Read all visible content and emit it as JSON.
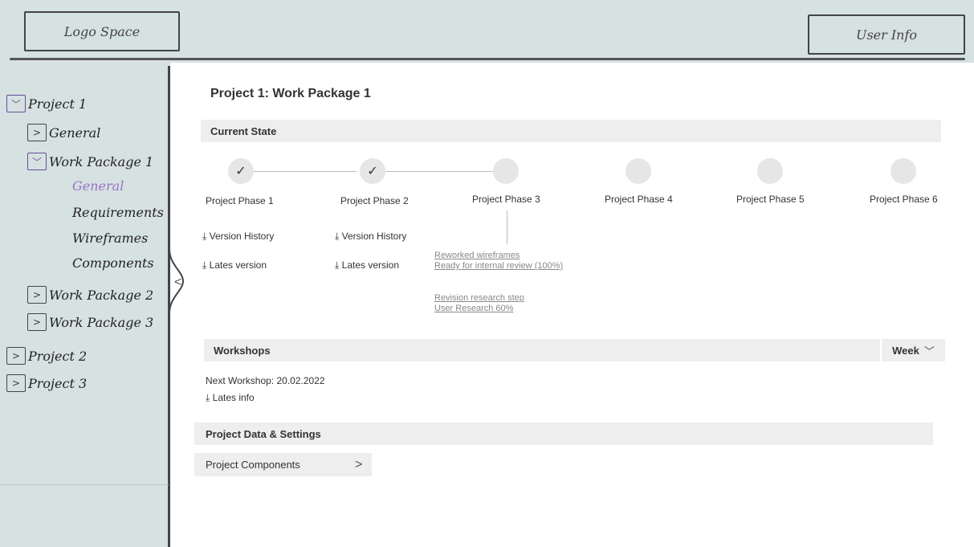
{
  "header": {
    "logo": "Logo Space",
    "user": "User Info"
  },
  "sidebar": {
    "projects": [
      {
        "label": "Project 1",
        "toggle": "﹀"
      },
      {
        "label": "Project 2",
        "toggle": ">"
      },
      {
        "label": "Project 3",
        "toggle": ">"
      }
    ],
    "project1_children": [
      {
        "label": "General",
        "toggle": ">"
      },
      {
        "label": "Work Package 1",
        "toggle": "﹀"
      },
      {
        "label": "Work Package 2",
        "toggle": ">"
      },
      {
        "label": "Work Package 3",
        "toggle": ">"
      }
    ],
    "wp1_pages": [
      "General",
      "Requirements",
      "Wireframes",
      "Components"
    ],
    "collapse_icon": "<"
  },
  "main": {
    "title": "Project 1: Work Package 1",
    "current_state": {
      "heading": "Current State",
      "phases": [
        {
          "label": "Project Phase 1",
          "mark": "✓",
          "done": true
        },
        {
          "label": "Project Phase 2",
          "mark": "✓",
          "done": true
        },
        {
          "label": "Project Phase 3",
          "mark": "",
          "done": false
        },
        {
          "label": "Project Phase 4",
          "mark": "",
          "done": false
        },
        {
          "label": "Project Phase 5",
          "mark": "",
          "done": false
        },
        {
          "label": "Project Phase 6",
          "mark": "",
          "done": false
        }
      ],
      "downloads": {
        "history": "Version History",
        "latest": "Lates version",
        "icon": "⤓"
      },
      "updates": [
        {
          "line1": "Reworked wireframes",
          "line2": "Ready for internal review (100%)"
        },
        {
          "line1": "Revision research step",
          "line2": "User Research 60%"
        }
      ]
    },
    "workshops": {
      "heading": "Workshops",
      "filter": "Week",
      "filter_icon": "﹀",
      "next": "Next Workshop: 20.02.2022",
      "latest_info": "Lates info"
    },
    "settings": {
      "heading": "Project Data & Settings",
      "components": "Project Components",
      "components_icon": ">"
    }
  },
  "colors": {
    "panel": "#d6e1e1",
    "accent": "#9a72c6",
    "bar": "#eeeeee"
  }
}
